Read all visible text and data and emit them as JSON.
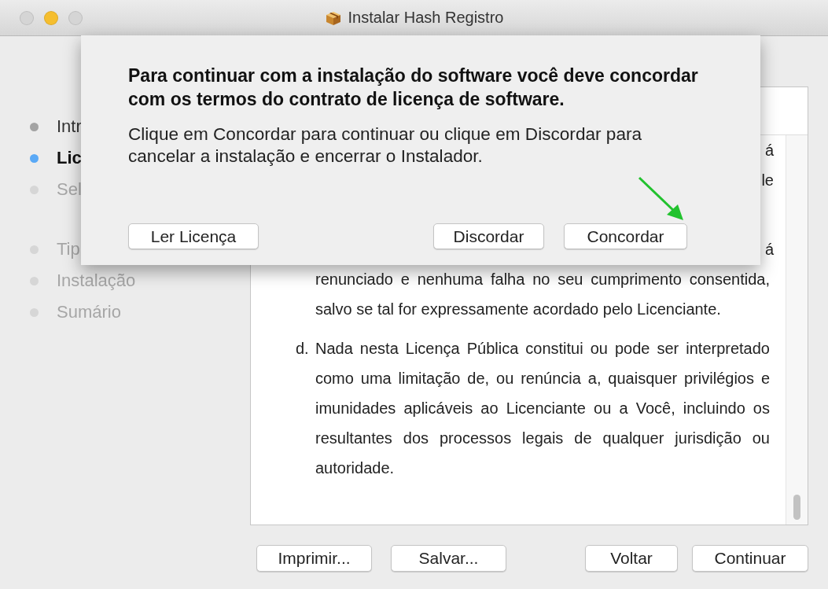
{
  "window": {
    "title": "Instalar Hash Registro",
    "controls": [
      {
        "color": "#d5d5d5"
      },
      {
        "color": "#f5be2f"
      },
      {
        "color": "#d5d5d5"
      }
    ]
  },
  "sidebar": {
    "items": [
      {
        "label": "Intr",
        "selected": false,
        "completed": true,
        "gap_before": false
      },
      {
        "label": "Lic",
        "selected": true,
        "completed": false,
        "gap_before": false
      },
      {
        "label": "Sel",
        "selected": false,
        "completed": false,
        "gap_before": false
      },
      {
        "label": "Tip",
        "selected": false,
        "completed": false,
        "gap_before": true
      },
      {
        "label": "Instalação",
        "selected": false,
        "completed": false,
        "gap_before": false
      },
      {
        "label": "Sumário",
        "selected": false,
        "completed": false,
        "gap_before": false
      }
    ]
  },
  "license_text": [
    {
      "kind": "fragment",
      "lines": [
        "á",
        "le"
      ]
    },
    {
      "kind": "continued",
      "fragment_lines": [
        "á"
      ],
      "lines": [
        "renunciado e nenhuma falha no seu cumprimento consentida,",
        "salvo se tal for expressamente acordado pelo Licenciante."
      ]
    },
    {
      "kind": "item",
      "marker": "d.",
      "lines": [
        "Nada nesta Licença Pública constitui ou pode ser interpretado",
        "como uma limitação de, ou renúncia a, quaisquer privilégios e",
        "imunidades aplicáveis ao Licenciante ou a Você, incluindo os",
        "resultantes dos processos legais de qualquer jurisdição ou",
        "autoridade."
      ]
    }
  ],
  "buttons_left": [
    "Imprimir...",
    "Salvar..."
  ],
  "buttons_right": [
    "Voltar",
    "Continuar"
  ],
  "sheet": {
    "title": "Para continuar com a instalação do software você deve concordar com os termos do contrato de licença de software.",
    "message": "Clique em Concordar para continuar ou clique em Discordar para cancelar a instalação e encerrar o Instalador.",
    "button_left": "Ler Licença",
    "buttons_right": [
      "Discordar",
      "Concordar"
    ]
  }
}
